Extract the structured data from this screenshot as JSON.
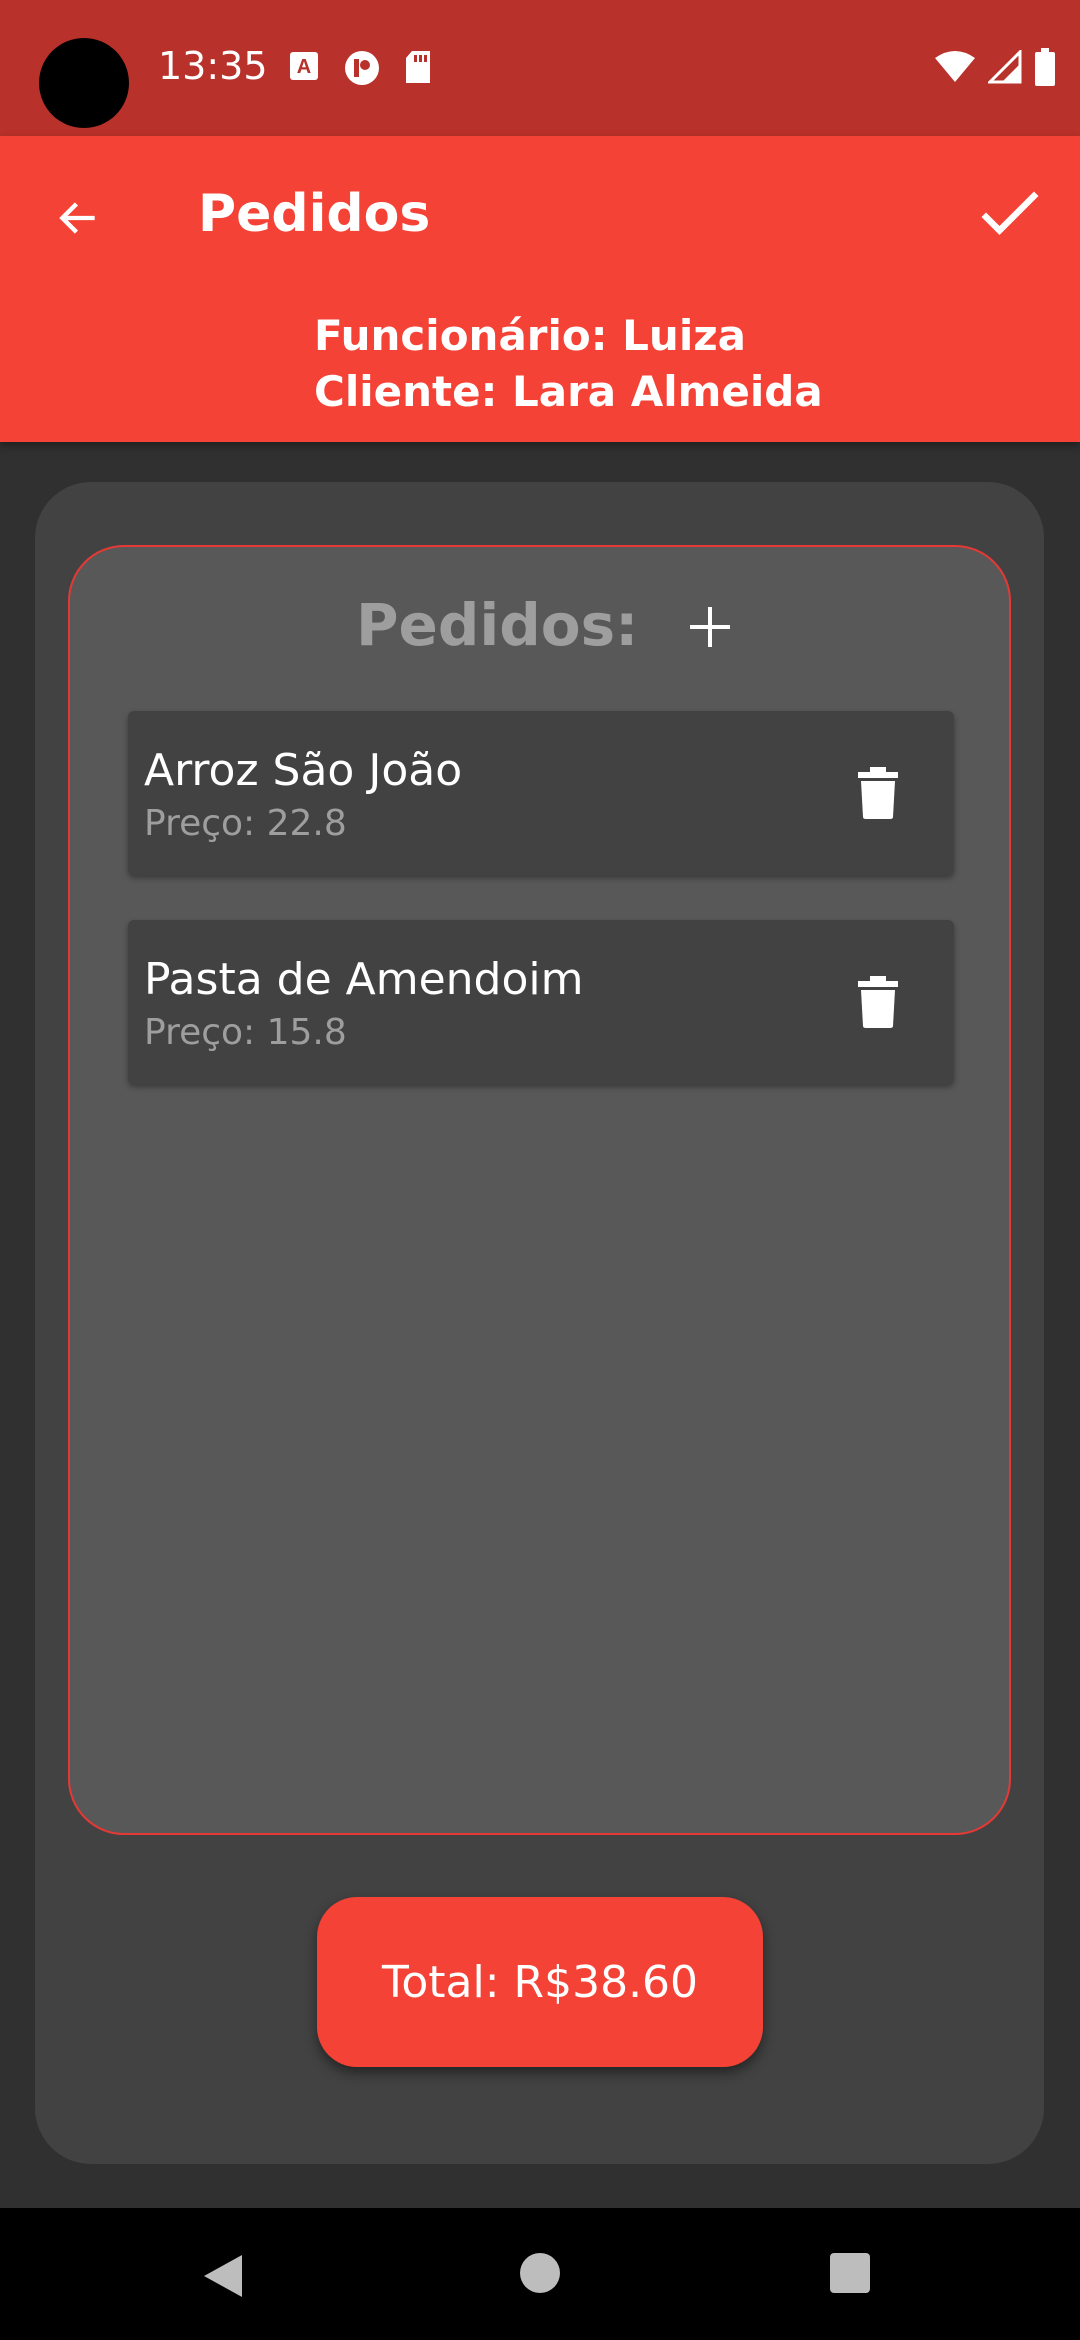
{
  "status_bar": {
    "time": "13:35",
    "left_icons": [
      "app-a-icon",
      "app-p-icon",
      "sd-card-icon"
    ],
    "right_icons": [
      "wifi-icon",
      "signal-icon",
      "battery-icon"
    ]
  },
  "app_bar": {
    "title": "Pedidos",
    "back_icon": "arrow-back-icon",
    "confirm_icon": "check-icon",
    "employee_line": "Funcionário: Luiza",
    "client_line": "Cliente: Lara Almeida"
  },
  "orders": {
    "title": "Pedidos:",
    "add_icon": "plus-icon",
    "items": [
      {
        "name": "Arroz São João",
        "price": "Preço: 22.8"
      },
      {
        "name": "Pasta de Amendoim",
        "price": "Preço: 15.8"
      }
    ]
  },
  "total": {
    "label": "Total: R$38.60"
  },
  "colors": {
    "status_bar": "#B8312A",
    "app_bar": "#F44336",
    "background": "#303030",
    "card": "#424242",
    "orders_box": "#585858",
    "accent_border": "#E53935"
  }
}
